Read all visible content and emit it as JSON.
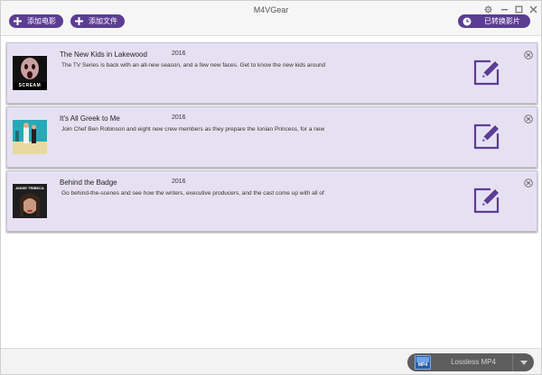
{
  "app": {
    "title": "M4VGear"
  },
  "toolbar": {
    "add_movie_label": "添加电影",
    "add_file_label": "添加文件",
    "converted_label": "已转换影片"
  },
  "colors": {
    "accent": "#5b3d93",
    "card_bg": "#e6e1f2",
    "format_bg": "#5d5d5d"
  },
  "items": [
    {
      "title": "The New Kids in Lakewood",
      "year": "2016",
      "description": "The TV Series is back with an all-new season, and a few new faces. Get to know the new kids around",
      "poster_text": "SCREAM"
    },
    {
      "title": "It's All Greek to Me",
      "year": "2016",
      "description": "Join Chef Ben Robinson and eight new crew members as they prepare the Ionian Princess, for a new",
      "poster_text": ""
    },
    {
      "title": "Behind the Badge",
      "year": "2016",
      "description": "Go behind-the-scenes and see how the writers, executive producers, and the cast come up with all of",
      "poster_text": "ANGIE TRIBECA"
    }
  ],
  "output": {
    "format_label": "Lossless MP4",
    "format_icon_text": "MP4"
  }
}
